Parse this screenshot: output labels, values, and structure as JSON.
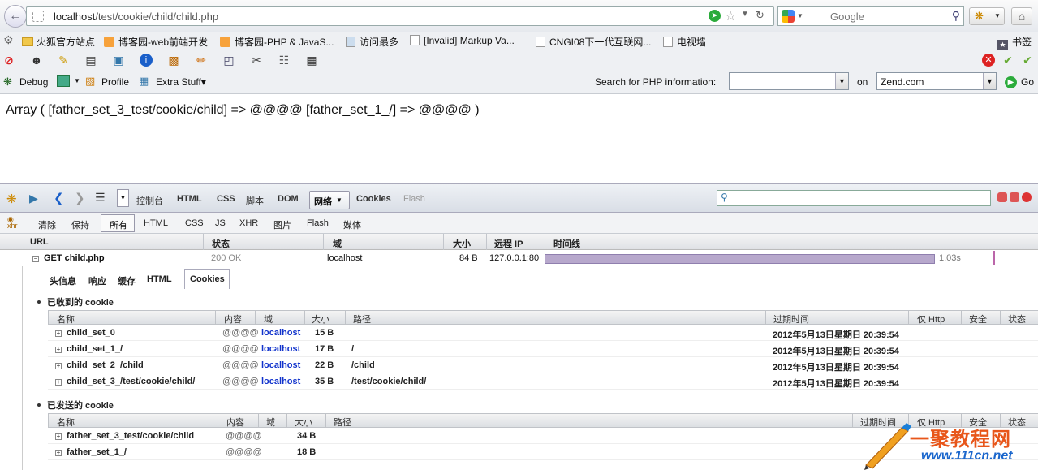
{
  "browser": {
    "url_host": "localhost",
    "url_path": "/test/cookie/child/child.php",
    "search_placeholder": "Google"
  },
  "bookmarks": {
    "items": [
      {
        "label": "火狐官方站点",
        "icon": "folder-icon"
      },
      {
        "label": "博客园-web前端开发",
        "icon": "rss-icon"
      },
      {
        "label": "博客园-PHP & JavaS...",
        "icon": "rss-icon"
      },
      {
        "label": "访问最多",
        "icon": "search-page-icon"
      },
      {
        "label": "[Invalid] Markup Va...",
        "icon": "page-icon"
      },
      {
        "label": "CNGI08下一代互联网...",
        "icon": "page-icon"
      },
      {
        "label": "电视墙",
        "icon": "page-icon"
      }
    ],
    "right_label": "书签"
  },
  "toolbar": {
    "debug_label": "Debug",
    "profile_label": "Profile",
    "extra_label": "Extra Stuff",
    "php_search_label": "Search for PHP information:",
    "on_label": "on",
    "site_value": "Zend.com",
    "go_label": "Go"
  },
  "page": {
    "content": "Array ( [father_set_3_test/cookie/child] => @@@@ [father_set_1_/] => @@@@ )"
  },
  "firebug": {
    "tabs": [
      "控制台",
      "HTML",
      "CSS",
      "脚本",
      "DOM"
    ],
    "active_tab": "网络",
    "tab_cookies": "Cookies",
    "tab_flash": "Flash",
    "filters": [
      "清除",
      "保持",
      "所有",
      "HTML",
      "CSS",
      "JS",
      "XHR",
      "图片",
      "Flash",
      "媒体"
    ],
    "columns": [
      "URL",
      "状态",
      "域",
      "大小",
      "远程 IP",
      "时间线"
    ],
    "request": {
      "url": "GET child.php",
      "status": "200 OK",
      "domain": "localhost",
      "size": "84 B",
      "remote_ip": "127.0.0.1:80",
      "time": "1.03s",
      "progress": 1.0
    },
    "detail_tabs": [
      "头信息",
      "响应",
      "缓存",
      "HTML",
      "Cookies"
    ],
    "received_title": "已收到的 cookie",
    "sent_title": "已发送的 cookie",
    "cookie_columns": [
      "名称",
      "内容",
      "域",
      "大小",
      "路径",
      "过期时间",
      "仅 Http",
      "安全",
      "状态"
    ],
    "received": [
      {
        "name": "child_set_0",
        "content": "@@@@",
        "domain": "localhost",
        "size": "15 B",
        "path": "",
        "expires": "2012年5月13日星期日 20:39:54"
      },
      {
        "name": "child_set_1_/",
        "content": "@@@@",
        "domain": "localhost",
        "size": "17 B",
        "path": "/",
        "expires": "2012年5月13日星期日 20:39:54"
      },
      {
        "name": "child_set_2_/child",
        "content": "@@@@",
        "domain": "localhost",
        "size": "22 B",
        "path": "/child",
        "expires": "2012年5月13日星期日 20:39:54"
      },
      {
        "name": "child_set_3_/test/cookie/child/",
        "content": "@@@@",
        "domain": "localhost",
        "size": "35 B",
        "path": "/test/cookie/child/",
        "expires": "2012年5月13日星期日 20:39:54"
      }
    ],
    "sent": [
      {
        "name": "father_set_3_test/cookie/child",
        "content": "@@@@",
        "size": "34 B"
      },
      {
        "name": "father_set_1_/",
        "content": "@@@@",
        "size": "18 B"
      }
    ],
    "sent_headers_right": [
      "过期时间",
      "仅 Http",
      "安全",
      "状态"
    ]
  },
  "watermark": {
    "text1": "一聚教程网",
    "text2": "www.111cn.net"
  }
}
